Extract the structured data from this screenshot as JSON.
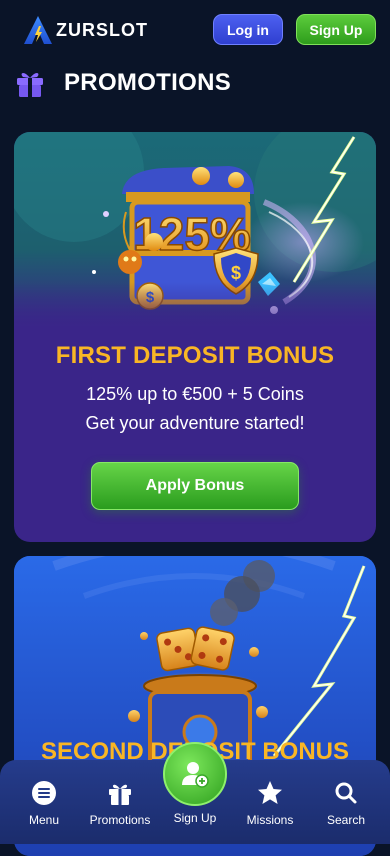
{
  "header": {
    "brand": "ZURSLOT",
    "login_label": "Log in",
    "signup_label": "Sign Up"
  },
  "page": {
    "title": "PROMOTIONS"
  },
  "promotions": [
    {
      "title": "FIRST DEPOSIT BONUS",
      "art_text": "125%",
      "line1": "125% up to €500 + 5 Coins",
      "line2": "Get your adventure started!",
      "button": "Apply Bonus"
    },
    {
      "title": "SECOND DEPOSIT BONUS"
    }
  ],
  "bottom_nav": {
    "items": [
      {
        "label": "Menu",
        "icon": "menu-icon"
      },
      {
        "label": "Promotions",
        "icon": "gift-icon"
      },
      {
        "label": "Sign Up",
        "icon": "add-user-icon"
      },
      {
        "label": "Missions",
        "icon": "star-icon"
      },
      {
        "label": "Search",
        "icon": "search-icon"
      }
    ]
  },
  "colors": {
    "background": "#0a1428",
    "accent_gold": "#f9b625",
    "card_purple": "#3a2589",
    "primary_blue": "#3b4ee0",
    "primary_green": "#3eae2a"
  }
}
